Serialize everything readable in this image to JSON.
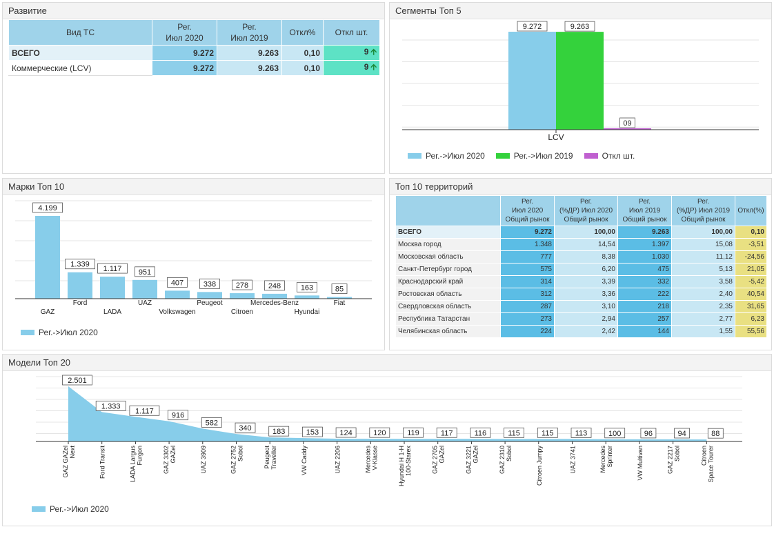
{
  "development": {
    "title": "Развитие",
    "headers": [
      "Вид ТС",
      "Рег.\nИюл 2020",
      "Рег.\nИюл 2019",
      "Откл%",
      "Откл шт."
    ],
    "rows": [
      {
        "label": "ВСЕГО",
        "v2020": "9.272",
        "v2019": "9.263",
        "pct": "0,10",
        "diff": "9"
      },
      {
        "label": "Коммерческие (LCV)",
        "v2020": "9.272",
        "v2019": "9.263",
        "pct": "0,10",
        "diff": "9"
      }
    ]
  },
  "segments": {
    "title": "Сегменты Топ 5",
    "chart_data": {
      "type": "bar",
      "categories": [
        "LCV"
      ],
      "series": [
        {
          "name": "Рег.->Июл 2020",
          "values": [
            9272
          ],
          "label": "9.272",
          "color": "#87cdea"
        },
        {
          "name": "Рег.->Июл 2019",
          "values": [
            9263
          ],
          "label": "9.263",
          "color": "#34d23c"
        },
        {
          "name": "Откл шт.",
          "values": [
            9
          ],
          "label": "09",
          "color": "#c060d0"
        }
      ],
      "ylim": [
        0,
        9272
      ]
    }
  },
  "brands": {
    "title": "Марки Топ 10",
    "chart_data": {
      "type": "bar",
      "categories": [
        "GAZ",
        "Ford",
        "LADA",
        "UAZ",
        "Volkswagen",
        "Peugeot",
        "Citroen",
        "Mercedes-Benz",
        "Hyundai",
        "Fiat"
      ],
      "values": [
        4199,
        1339,
        1117,
        951,
        407,
        338,
        278,
        248,
        163,
        85
      ],
      "labels": [
        "4.199",
        "1.339",
        "1.117",
        "951",
        "407",
        "338",
        "278",
        "248",
        "163",
        "85"
      ],
      "series_name": "Рег.->Июл 2020",
      "color": "#87cdea",
      "ylim": [
        0,
        4199
      ]
    }
  },
  "territories": {
    "title": "Топ 10 территорий",
    "headers": [
      "",
      "Рег.\nИюл 2020\nОбщий рынок",
      "Рег.\n(%ДР) Июл 2020\nОбщий рынок",
      "Рег.\nИюл 2019\nОбщий рынок",
      "Рег.\n(%ДР) Июл 2019\nОбщий рынок",
      "Откл(%)"
    ],
    "rows": [
      [
        "ВСЕГО",
        "9.272",
        "100,00",
        "9.263",
        "100,00",
        "0,10"
      ],
      [
        "Москва город",
        "1.348",
        "14,54",
        "1.397",
        "15,08",
        "-3,51"
      ],
      [
        "Московская область",
        "777",
        "8,38",
        "1.030",
        "11,12",
        "-24,56"
      ],
      [
        "Санкт-Петербург город",
        "575",
        "6,20",
        "475",
        "5,13",
        "21,05"
      ],
      [
        "Краснодарский край",
        "314",
        "3,39",
        "332",
        "3,58",
        "-5,42"
      ],
      [
        "Ростовская область",
        "312",
        "3,36",
        "222",
        "2,40",
        "40,54"
      ],
      [
        "Свердловская область",
        "287",
        "3,10",
        "218",
        "2,35",
        "31,65"
      ],
      [
        "Республика Татарстан",
        "273",
        "2,94",
        "257",
        "2,77",
        "6,23"
      ],
      [
        "Челябинская область",
        "224",
        "2,42",
        "144",
        "1,55",
        "55,56"
      ]
    ]
  },
  "models": {
    "title": "Модели Топ 20",
    "chart_data": {
      "type": "area",
      "categories": [
        "GAZ GAZel Next",
        "Ford Transit",
        "LADA Largus Furgon",
        "GAZ 3302 GAZel",
        "UAZ 3909",
        "GAZ 2752 Sobol",
        "Peugeot Traveller",
        "VW Caddy",
        "UAZ 2206",
        "Mercedes V-Klasse",
        "Hyundai H 1-H 100-Starex",
        "GAZ 2705 GAZel",
        "GAZ 3221 GAZel",
        "GAZ 2310 Sobol",
        "Citroen Jumpy",
        "UAZ 3741",
        "Mercedes Sprinter",
        "VW Multivan",
        "GAZ 2217 Sobol",
        "Citroen Space Tourer"
      ],
      "tick_lines": [
        [
          "GAZ GAZel",
          "Next"
        ],
        [
          "Ford Transit"
        ],
        [
          "LADA Largus",
          "Furgon"
        ],
        [
          "GAZ 3302",
          "GAZel"
        ],
        [
          "UAZ 3909"
        ],
        [
          "GAZ 2752",
          "Sobol"
        ],
        [
          "Peugeot",
          "Traveller"
        ],
        [
          "VW Caddy"
        ],
        [
          "UAZ 2206"
        ],
        [
          "Mercedes",
          "V-Klasse"
        ],
        [
          "Hyundai H 1-H",
          "100-Starex"
        ],
        [
          "GAZ 2705",
          "GAZel"
        ],
        [
          "GAZ 3221",
          "GAZel"
        ],
        [
          "GAZ 2310",
          "Sobol"
        ],
        [
          "Citroen Jumpy"
        ],
        [
          "UAZ 3741"
        ],
        [
          "Mercedes",
          "Sprinter"
        ],
        [
          "VW Multivan"
        ],
        [
          "GAZ 2217",
          "Sobol"
        ],
        [
          "Citroen",
          "Space Tourer"
        ]
      ],
      "values": [
        2501,
        1333,
        1117,
        916,
        582,
        340,
        183,
        153,
        124,
        120,
        119,
        117,
        116,
        115,
        115,
        113,
        100,
        96,
        94,
        88
      ],
      "labels": [
        "2.501",
        "1.333",
        "1.117",
        "916",
        "582",
        "340",
        "183",
        "153",
        "124",
        "120",
        "119",
        "117",
        "116",
        "115",
        "115",
        "113",
        "100",
        "96",
        "94",
        "88"
      ],
      "series_name": "Рег.->Июл 2020",
      "color": "#87cdea",
      "ylim": [
        0,
        2501
      ]
    }
  }
}
